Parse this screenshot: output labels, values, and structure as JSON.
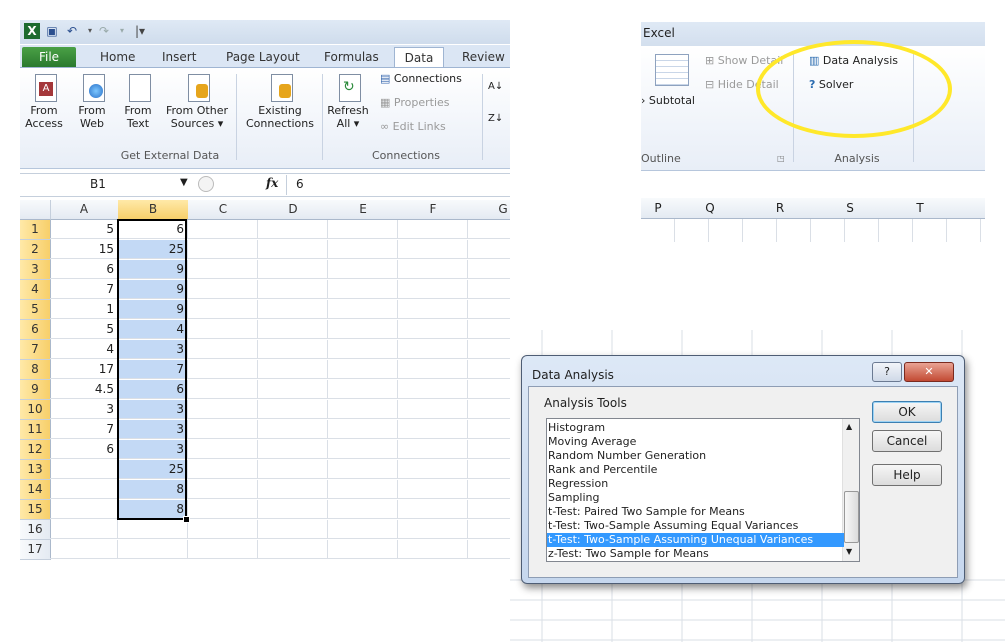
{
  "left_window": {
    "tabs": [
      "File",
      "Home",
      "Insert",
      "Page Layout",
      "Formulas",
      "Data",
      "Review"
    ],
    "active_tab": "Data",
    "get_external": {
      "from_access": [
        "From",
        "Access"
      ],
      "from_web": [
        "From",
        "Web"
      ],
      "from_text": [
        "From",
        "Text"
      ],
      "from_other": [
        "From Other",
        "Sources ▾"
      ],
      "existing": [
        "Existing",
        "Connections"
      ],
      "group_label": "Get External Data"
    },
    "connections": {
      "refresh": [
        "Refresh",
        "All ▾"
      ],
      "items": [
        "Connections",
        "Properties",
        "Edit Links"
      ],
      "group_label": "Connections"
    },
    "sort_icons": [
      "A↓",
      "Z↓"
    ],
    "formula_bar": {
      "name_box": "B1",
      "fx": "fx",
      "value": "6"
    },
    "columns": [
      "A",
      "B",
      "C",
      "D",
      "E",
      "F",
      "G"
    ],
    "rows": [
      "1",
      "2",
      "3",
      "4",
      "5",
      "6",
      "7",
      "8",
      "9",
      "10",
      "11",
      "12",
      "13",
      "14",
      "15",
      "16",
      "17"
    ],
    "col_a": [
      "5",
      "15",
      "6",
      "7",
      "1",
      "5",
      "4",
      "17",
      "4.5",
      "3",
      "7",
      "6",
      "",
      "",
      "",
      "",
      ""
    ],
    "col_b": [
      "6",
      "25",
      "9",
      "9",
      "9",
      "4",
      "3",
      "7",
      "6",
      "3",
      "3",
      "3",
      "25",
      "8",
      "8",
      "",
      ""
    ]
  },
  "right_fragment": {
    "app_title": "Excel",
    "show_detail": "Show Detail",
    "hide_detail": "Hide Detail",
    "subtotal": "› Subtotal",
    "outline_label": "Outline",
    "data_analysis": "Data Analysis",
    "solver": "Solver",
    "analysis_label": "Analysis",
    "columns": [
      "P",
      "Q",
      "R",
      "S",
      "T"
    ],
    "highlight_color": "#ffe82a"
  },
  "dialog": {
    "title": "Data Analysis",
    "help_glyph": "?",
    "close_glyph": "✕",
    "analysis_tools_label": "Analysis Tools",
    "tools": [
      "Histogram",
      "Moving Average",
      "Random Number Generation",
      "Rank and Percentile",
      "Regression",
      "Sampling",
      "t-Test: Paired Two Sample for Means",
      "t-Test: Two-Sample Assuming Equal Variances",
      "t-Test: Two-Sample Assuming Unequal Variances",
      "z-Test: Two Sample for Means"
    ],
    "selected_tool": "t-Test: Two-Sample Assuming Unequal Variances",
    "ok": "OK",
    "cancel": "Cancel",
    "help": "Help"
  }
}
